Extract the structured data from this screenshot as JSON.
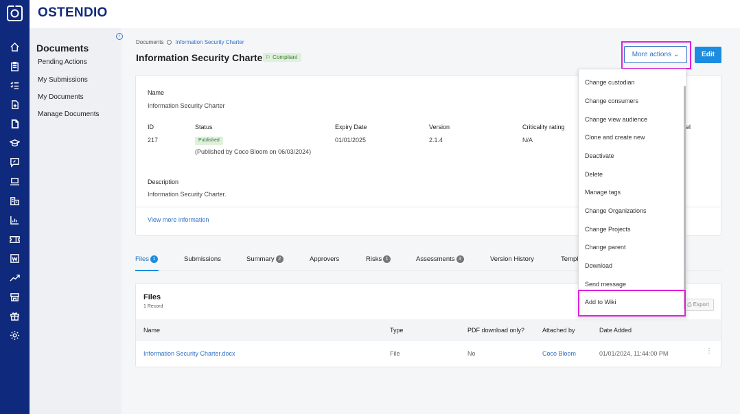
{
  "app": {
    "brand": "OSTENDIO"
  },
  "rail_icons": [
    "home-icon",
    "clipboard-icon",
    "checklist-icon",
    "file-plus-icon",
    "document-icon",
    "graduation-cap-icon",
    "chat-icon",
    "laptop-icon",
    "buildings-icon",
    "chart-bar-icon",
    "ticket-icon",
    "wiki-icon",
    "trend-icon",
    "store-icon",
    "gift-icon",
    "gear-icon"
  ],
  "subnav": {
    "title": "Documents",
    "items": [
      "Pending Actions",
      "My Submissions",
      "My Documents",
      "Manage Documents"
    ]
  },
  "breadcrumb": {
    "root": "Documents",
    "current": "Information Security Charter"
  },
  "page": {
    "title": "Information Security Charter",
    "status_badge": "Compliant",
    "more_actions_label": "More actions",
    "edit_label": "Edit"
  },
  "info": {
    "name_label": "Name",
    "name_value": "Information Security Charter",
    "id_label": "ID",
    "id_value": "217",
    "status_label": "Status",
    "status_badge": "Published",
    "status_note": "(Published by Coco Bloom on 06/03/2024)",
    "expiry_label": "Expiry Date",
    "expiry_value": "01/01/2025",
    "version_label": "Version",
    "version_value": "2.1.4",
    "criticality_label": "Criticality rating",
    "criticality_value": "N/A",
    "hidden_label_tail": "el",
    "description_label": "Description",
    "description_value": "Information Security Charter.",
    "view_more": "View more information"
  },
  "tabs": [
    {
      "label": "Files",
      "count": "1"
    },
    {
      "label": "Submissions",
      "count": ""
    },
    {
      "label": "Summary",
      "count": "2"
    },
    {
      "label": "Approvers",
      "count": ""
    },
    {
      "label": "Risks",
      "count": "1"
    },
    {
      "label": "Assessments",
      "count": "3"
    },
    {
      "label": "Version History",
      "count": ""
    },
    {
      "label": "Templ",
      "count": ""
    }
  ],
  "files": {
    "title": "Files",
    "count_text": "1 Record",
    "export_label": "Export",
    "columns": [
      "Name",
      "Type",
      "PDF download only?",
      "Attached by",
      "Date Added"
    ],
    "rows": [
      {
        "name": "Information Security Charter.docx",
        "type": "File",
        "pdf_only": "No",
        "attached_by": "Coco Bloom",
        "date_added": "01/01/2024, 11:44:00 PM"
      }
    ]
  },
  "menu": {
    "items": [
      "Change custodian",
      "Change consumers",
      "Change view audience",
      "Clone and create new",
      "Deactivate",
      "Delete",
      "Manage tags",
      "Change Organizations",
      "Change Projects",
      "Change parent",
      "Download",
      "Send message",
      "Add to Wiki"
    ]
  },
  "colors": {
    "rail": "#0f2a7c",
    "accent": "#1b8ce0",
    "link": "#2f6fc4",
    "highlight": "#e020e0",
    "success_bg": "#dff0dc"
  }
}
